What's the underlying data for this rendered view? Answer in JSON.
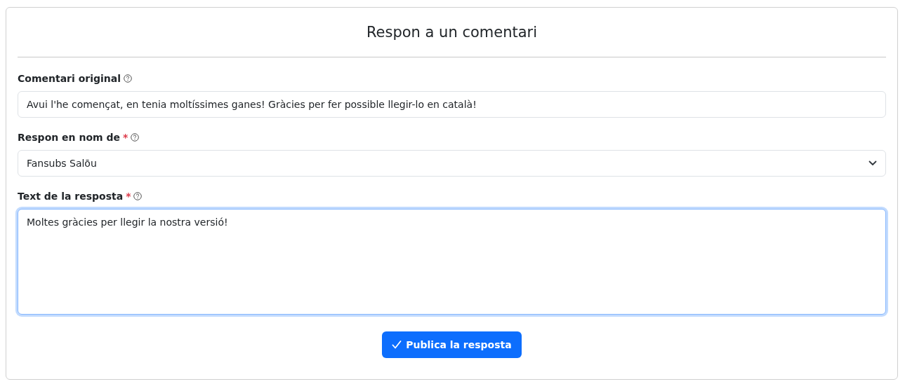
{
  "title": "Respon a un comentari",
  "fields": [
    {
      "kind": "input",
      "label": "Comentari original",
      "required": false,
      "focused": false,
      "value": "Avui l'he començat, en tenia moltíssimes ganes! Gràcies per fer possible llegir-lo en català!"
    },
    {
      "kind": "select",
      "label": "Respon en nom de",
      "required": true,
      "focused": false,
      "value": "Fansubs Salōu"
    },
    {
      "kind": "textarea",
      "label": "Text de la resposta",
      "required": true,
      "focused": true,
      "value": "Moltes gràcies per llegir la nostra versió!"
    }
  ],
  "required_mark": "*",
  "submit_button": "Publica la resposta"
}
